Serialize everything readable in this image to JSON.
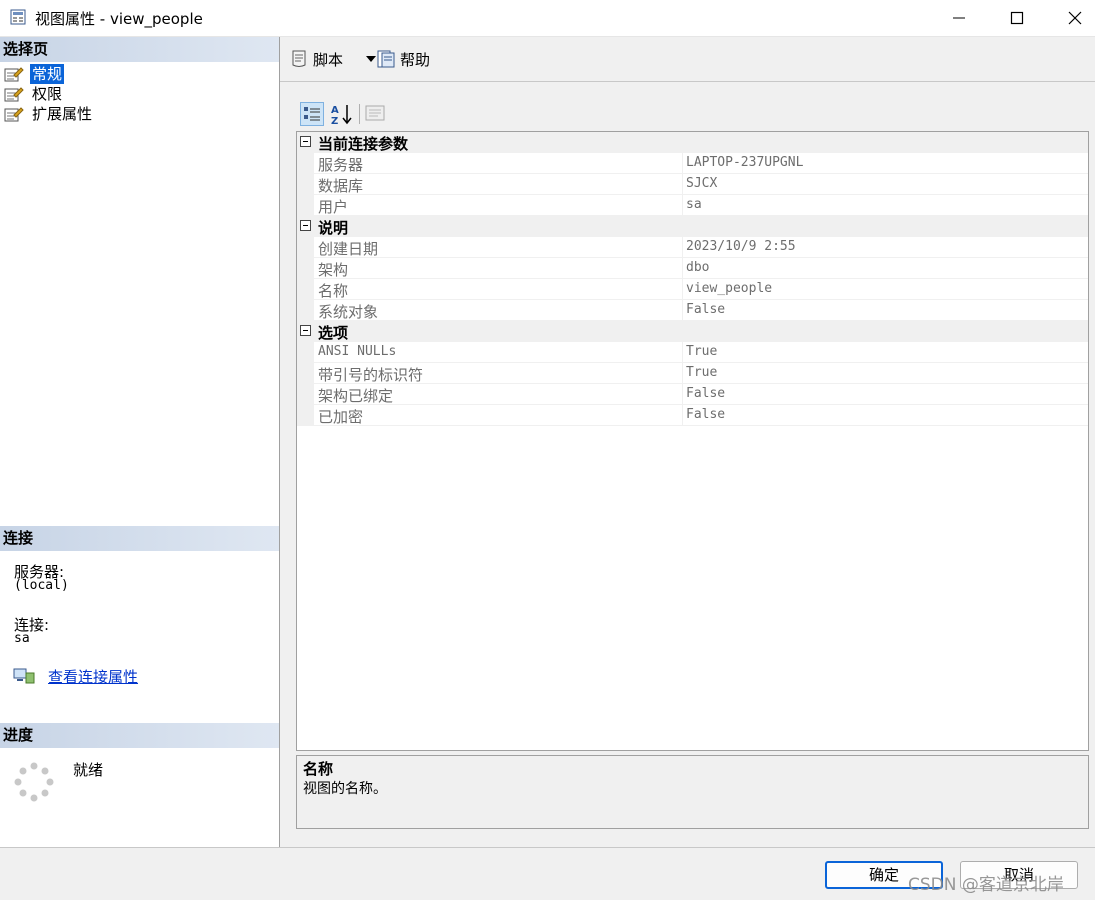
{
  "window": {
    "title": "视图属性 - view_people"
  },
  "left": {
    "select_page_header": "选择页",
    "pages": [
      {
        "label": "常规",
        "selected": true
      },
      {
        "label": "权限",
        "selected": false
      },
      {
        "label": "扩展属性",
        "selected": false
      }
    ],
    "connection_header": "连接",
    "server_label": "服务器:",
    "server_value": "(local)",
    "connection_label": "连接:",
    "connection_value": "sa",
    "view_connection_link": "查看连接属性",
    "progress_header": "进度",
    "progress_status": "就绪"
  },
  "toolbar": {
    "script_label": "脚本",
    "help_label": "帮助"
  },
  "grid": {
    "categories": [
      {
        "label": "当前连接参数",
        "props": [
          {
            "name": "服务器",
            "value": "LAPTOP-237UPGNL"
          },
          {
            "name": "数据库",
            "value": "SJCX"
          },
          {
            "name": "用户",
            "value": "sa"
          }
        ]
      },
      {
        "label": "说明",
        "props": [
          {
            "name": "创建日期",
            "value": "2023/10/9 2:55"
          },
          {
            "name": "架构",
            "value": "dbo"
          },
          {
            "name": "名称",
            "value": "view_people"
          },
          {
            "name": "系统对象",
            "value": "False"
          }
        ]
      },
      {
        "label": "选项",
        "props": [
          {
            "name": "ANSI NULLs",
            "value": "True"
          },
          {
            "name": "带引号的标识符",
            "value": "True"
          },
          {
            "name": "架构已绑定",
            "value": "False"
          },
          {
            "name": "已加密",
            "value": "False"
          }
        ]
      }
    ]
  },
  "description": {
    "title": "名称",
    "text": "视图的名称。"
  },
  "buttons": {
    "ok": "确定",
    "cancel": "取消"
  },
  "watermark": "CSDN @客道京北岸",
  "colors": {
    "selection": "#0a64d8",
    "header_gradient": "#c7d4e6",
    "link": "#0033cc"
  }
}
